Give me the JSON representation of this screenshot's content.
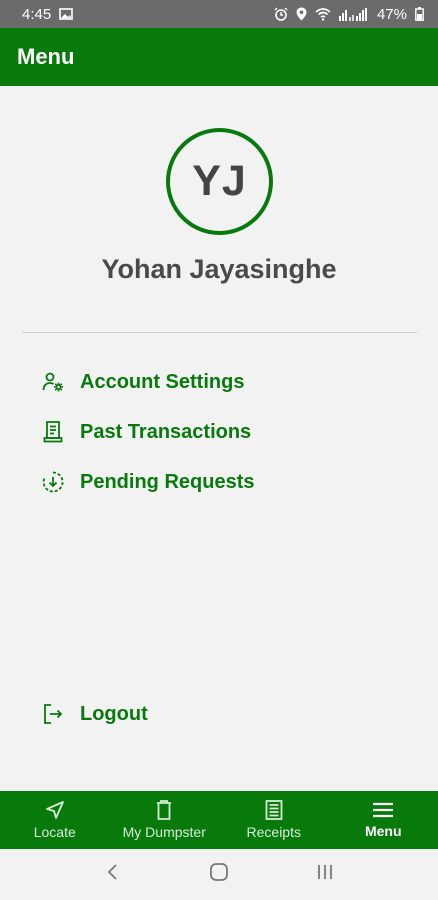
{
  "status_bar": {
    "time": "4:45",
    "battery": "47%",
    "icons": [
      "image-icon",
      "alarm-icon",
      "location-icon",
      "wifi-icon",
      "signal-icon",
      "battery-icon"
    ]
  },
  "app_bar": {
    "title": "Menu"
  },
  "profile": {
    "initials": "YJ",
    "name": "Yohan Jayasinghe"
  },
  "menu": {
    "items": [
      {
        "label": "Account Settings",
        "icon": "account-settings-icon"
      },
      {
        "label": "Past Transactions",
        "icon": "receipt-icon"
      },
      {
        "label": "Pending Requests",
        "icon": "pending-download-icon"
      }
    ],
    "logout": {
      "label": "Logout",
      "icon": "logout-icon"
    }
  },
  "bottom_nav": {
    "items": [
      {
        "label": "Locate",
        "icon": "navigation-arrow-icon",
        "active": false
      },
      {
        "label": "My Dumpster",
        "icon": "trash-bin-icon",
        "active": false
      },
      {
        "label": "Receipts",
        "icon": "receipt-list-icon",
        "active": false
      },
      {
        "label": "Menu",
        "icon": "hamburger-menu-icon",
        "active": true
      }
    ]
  },
  "colors": {
    "brand_green": "#087a0c",
    "status_bar": "#6b6b6b",
    "background": "#f2f2f2",
    "name_text": "#4a4a4a"
  }
}
